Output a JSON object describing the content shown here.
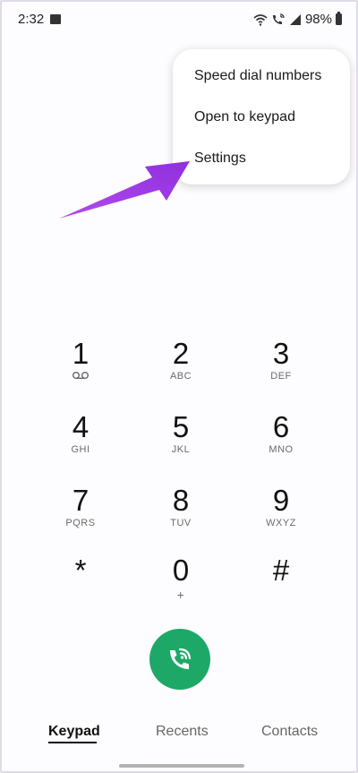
{
  "status_bar": {
    "time": "2:32",
    "battery": "98%"
  },
  "overflow_menu": {
    "items": [
      "Speed dial numbers",
      "Open to keypad",
      "Settings"
    ]
  },
  "keypad": {
    "keys": [
      {
        "digit": "1",
        "letters": ""
      },
      {
        "digit": "2",
        "letters": "ABC"
      },
      {
        "digit": "3",
        "letters": "DEF"
      },
      {
        "digit": "4",
        "letters": "GHI"
      },
      {
        "digit": "5",
        "letters": "JKL"
      },
      {
        "digit": "6",
        "letters": "MNO"
      },
      {
        "digit": "7",
        "letters": "PQRS"
      },
      {
        "digit": "8",
        "letters": "TUV"
      },
      {
        "digit": "9",
        "letters": "WXYZ"
      },
      {
        "digit": "*",
        "letters": ""
      },
      {
        "digit": "0",
        "letters": "+"
      },
      {
        "digit": "#",
        "letters": ""
      }
    ]
  },
  "tabs": [
    "Keypad",
    "Recents",
    "Contacts"
  ],
  "colors": {
    "call_button": "#1ea868",
    "annotation_arrow": "#a23ee0"
  },
  "icons": {
    "voicemail": "voicemail-icon",
    "call": "wifi-call-icon"
  }
}
